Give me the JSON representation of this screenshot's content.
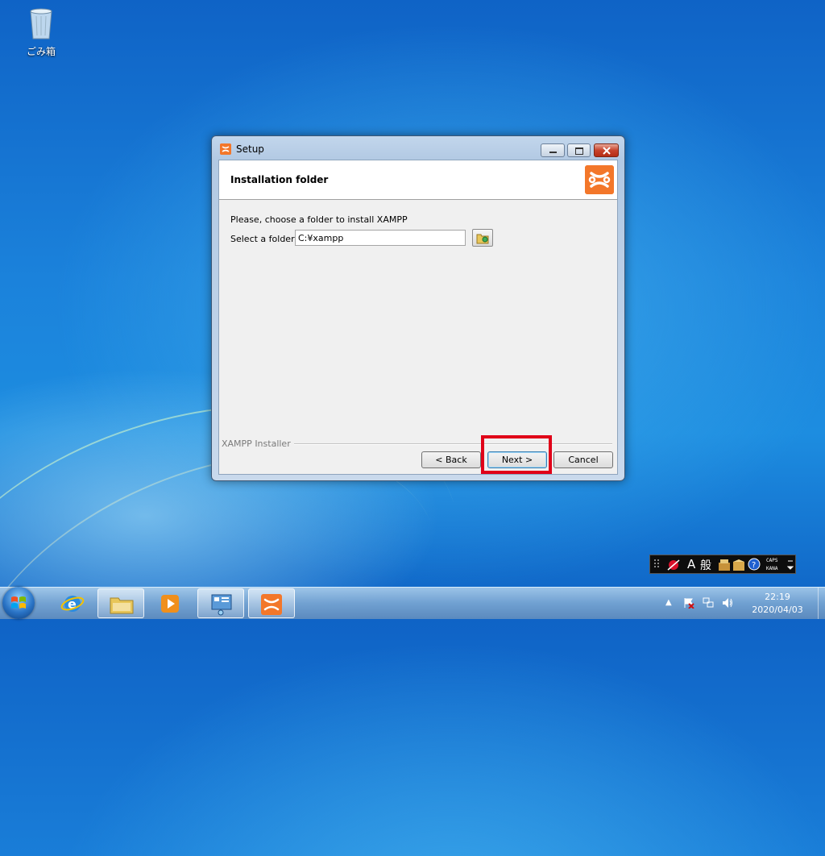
{
  "desktop": {
    "icons": [
      {
        "label": "ごみ箱"
      }
    ]
  },
  "window": {
    "title": "Setup",
    "header_title": "Installation folder",
    "prompt": "Please, choose a folder to install XAMPP",
    "folder_label": "Select a folder",
    "folder_value": "C:¥xampp",
    "group_label": "XAMPP Installer",
    "buttons": {
      "back": "< Back",
      "next": "Next >",
      "cancel": "Cancel"
    }
  },
  "langbar": {
    "input_mode": "A",
    "kanji": "般",
    "caps": "CAPS",
    "kana": "KANA"
  },
  "taskbar": {
    "pinned": [
      "internet-explorer-icon",
      "file-explorer-icon",
      "media-player-icon",
      "remote-desktop-icon",
      "xampp-icon"
    ],
    "clock_time": "22:19",
    "clock_date": "2020/04/03"
  },
  "colors": {
    "xampp_orange": "#f3772a",
    "highlight_red": "#e00018",
    "desktop_blue": "#1b82db"
  }
}
